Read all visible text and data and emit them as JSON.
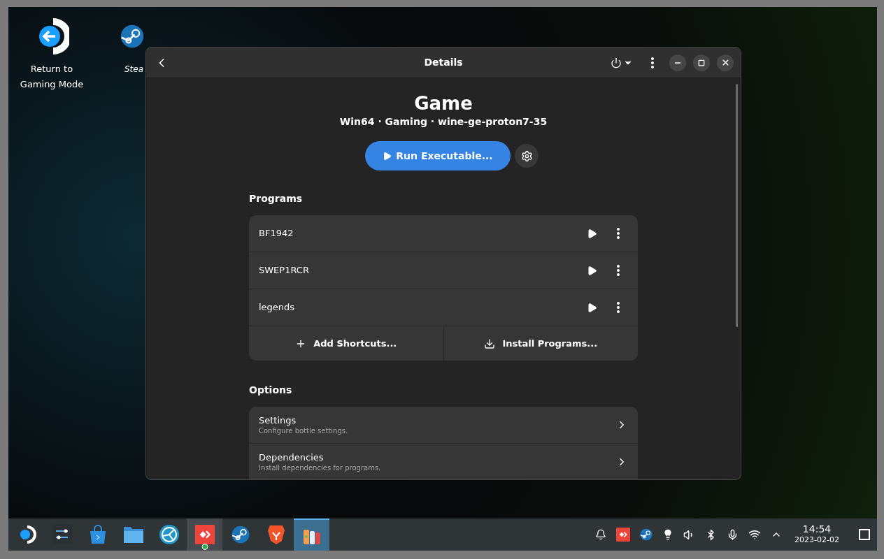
{
  "desktop_icons": [
    {
      "label": "Return to\nGaming Mode",
      "italic": false
    },
    {
      "label": "Stea",
      "italic": true
    }
  ],
  "window": {
    "title": "Details",
    "header": {
      "name": "Game",
      "subtitle": "Win64 · Gaming · wine-ge-proton7-35"
    },
    "run_button": "Run Executable...",
    "programs": {
      "title": "Programs",
      "items": [
        {
          "name": "BF1942"
        },
        {
          "name": "SWEP1RCR"
        },
        {
          "name": "legends"
        }
      ],
      "actions": [
        "Add Shortcuts...",
        "Install Programs..."
      ]
    },
    "options": {
      "title": "Options",
      "items": [
        {
          "title": "Settings",
          "subtitle": "Configure bottle settings."
        },
        {
          "title": "Dependencies",
          "subtitle": "Install dependencies for programs."
        }
      ]
    }
  },
  "taskbar": {
    "apps": [
      {
        "selected": false,
        "hovered": false
      },
      {
        "selected": false,
        "hovered": false
      },
      {
        "selected": false,
        "hovered": false
      },
      {
        "selected": false,
        "hovered": false
      },
      {
        "selected": false,
        "hovered": false
      },
      {
        "selected": false,
        "hovered": true
      },
      {
        "selected": false,
        "hovered": false
      },
      {
        "selected": false,
        "hovered": false
      },
      {
        "selected": true,
        "hovered": false
      }
    ],
    "clock": {
      "time": "14:54",
      "date": "2023-02-02"
    }
  }
}
